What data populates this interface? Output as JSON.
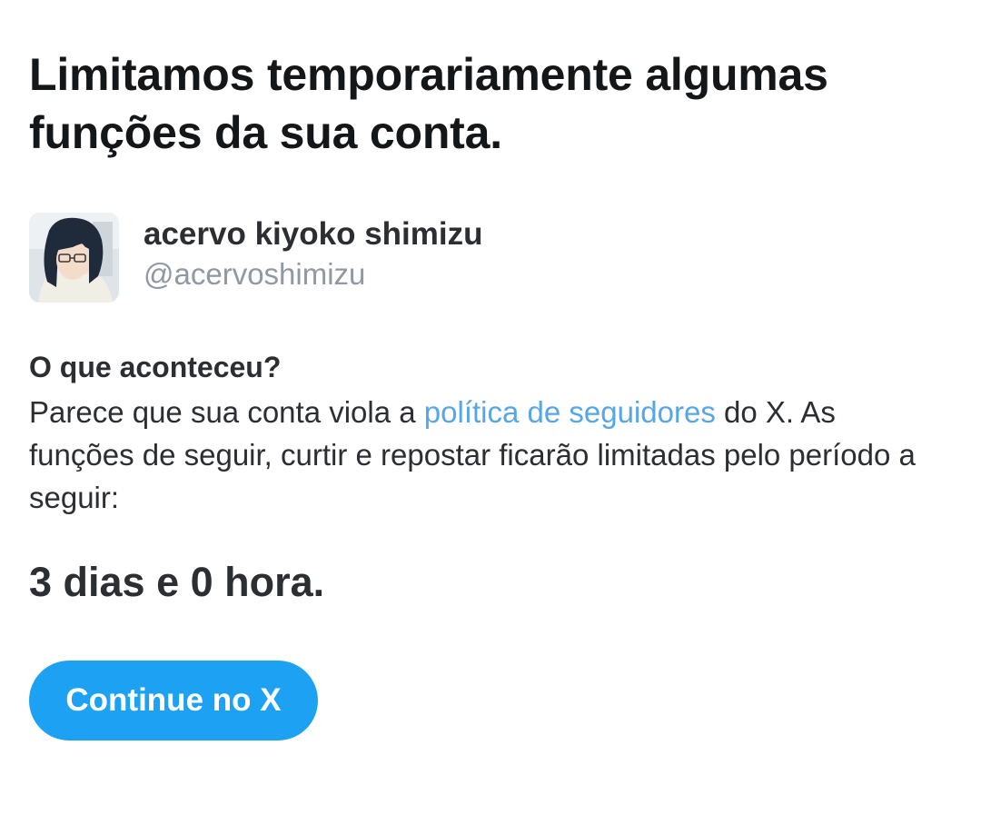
{
  "headline": "Limitamos temporariamente algumas funções da sua conta.",
  "account": {
    "display_name": "acervo kiyoko shimizu",
    "handle": "@acervoshimizu"
  },
  "section": {
    "title": "O que aconteceu?",
    "body_before_link": "Parece que sua conta viola a ",
    "link_text": "política de seguidores",
    "body_after_link": " do X. As funções de seguir, curtir e repostar ficarão limitadas pelo período a seguir:"
  },
  "duration": "3 dias e 0 hora.",
  "button": {
    "label": "Continue no X"
  },
  "colors": {
    "accent": "#1da1f2",
    "link": "#57a6e6",
    "text": "#2b2e33",
    "muted": "#8f98a3"
  },
  "icons": {
    "avatar": "profile-avatar-image"
  }
}
